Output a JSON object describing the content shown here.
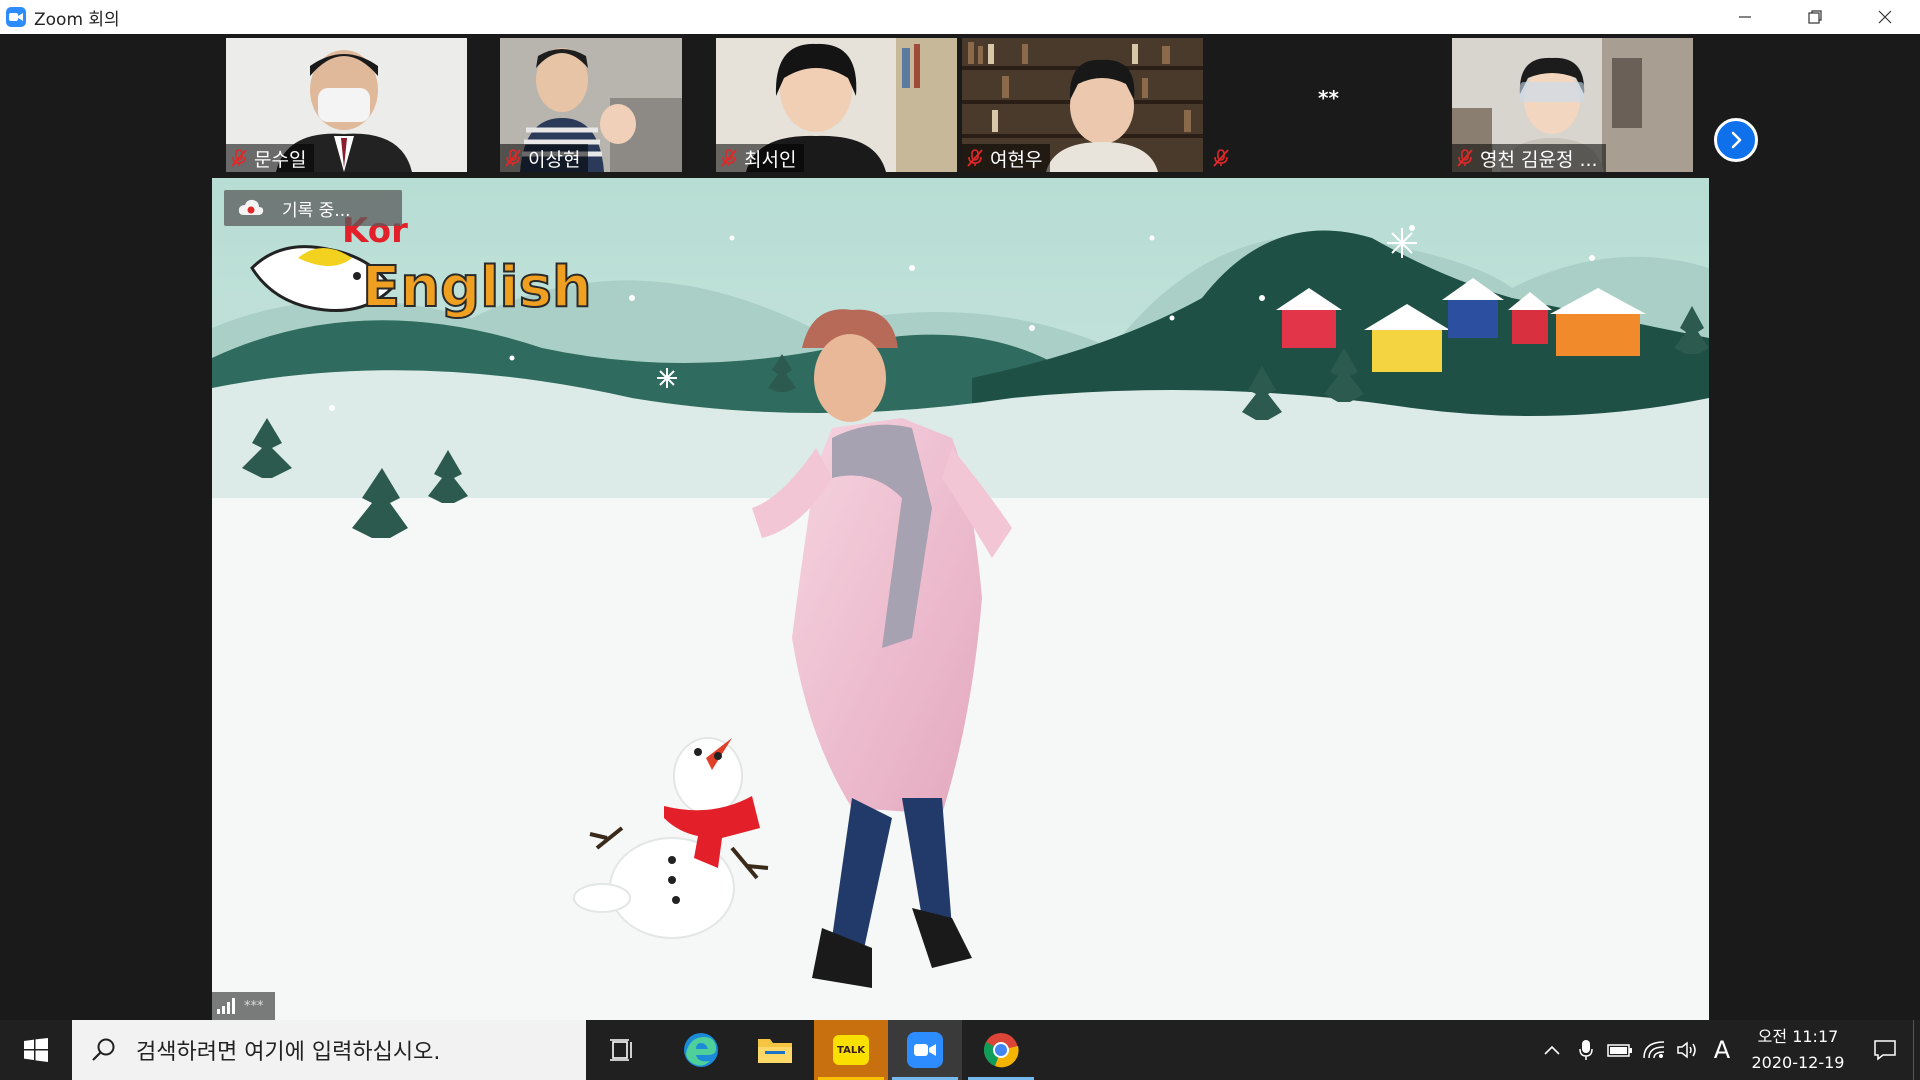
{
  "window": {
    "title": "Zoom 회의"
  },
  "gallery": {
    "participants": [
      {
        "name": "문수일",
        "muted": true
      },
      {
        "name": "이상현",
        "muted": true
      },
      {
        "name": "최서인",
        "muted": true
      },
      {
        "name": "여현우",
        "muted": true
      },
      {
        "name": "**",
        "muted": true
      },
      {
        "name": "영천 김윤정 ...",
        "muted": true
      }
    ]
  },
  "main_video": {
    "recording_label": "기록 중...",
    "logo_text": "Kor English",
    "signal_label": "***"
  },
  "taskbar": {
    "search_placeholder": "검색하려면 여기에 입력하십시오.",
    "apps": [
      "task-view",
      "edge",
      "file-explorer",
      "kakaotalk",
      "zoom",
      "chrome"
    ],
    "kakao_label": "TALK",
    "clock_time": "오전 11:17",
    "clock_date": "2020-12-19",
    "ime_label": "A"
  },
  "colors": {
    "zoom_blue": "#2d8cff",
    "taskbar": "#202020",
    "mute_red": "#e02828"
  }
}
